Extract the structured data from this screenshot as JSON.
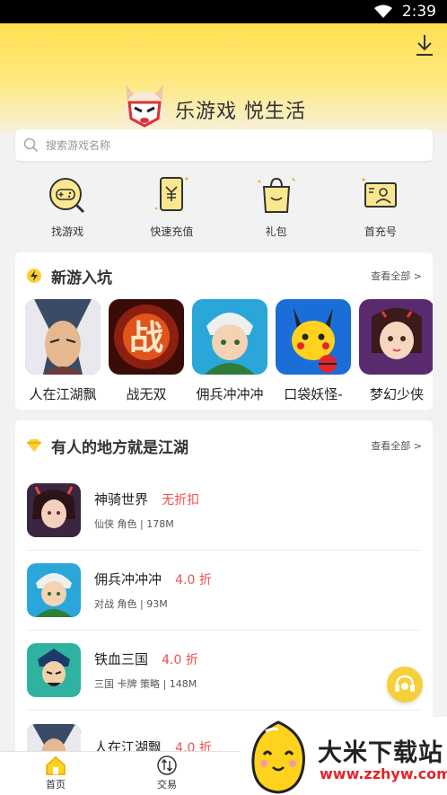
{
  "status": {
    "time": "2:39"
  },
  "header": {
    "slogan": "乐游戏 悦生活"
  },
  "search": {
    "placeholder": "搜索游戏名称"
  },
  "quick_actions": [
    {
      "label": "找游戏",
      "icon": "game-controller-icon"
    },
    {
      "label": "快速充值",
      "icon": "recharge-icon"
    },
    {
      "label": "礼包",
      "icon": "gift-bag-icon"
    },
    {
      "label": "首充号",
      "icon": "account-card-icon"
    }
  ],
  "new_games": {
    "title": "新游入坑",
    "more": "查看全部 >",
    "items": [
      {
        "name": "人在江湖飘"
      },
      {
        "name": "战无双"
      },
      {
        "name": "佣兵冲冲冲"
      },
      {
        "name": "口袋妖怪-"
      },
      {
        "name": "梦幻少侠"
      }
    ]
  },
  "jianghu": {
    "title": "有人的地方就是江湖",
    "more": "查看全部 >",
    "items": [
      {
        "name": "神骑世界",
        "discount": "无折扣",
        "meta": "仙侠 角色 | 178M"
      },
      {
        "name": "佣兵冲冲冲",
        "discount": "4.0 折",
        "meta": "对战 角色 | 93M"
      },
      {
        "name": "铁血三国",
        "discount": "4.0 折",
        "meta": "三国 卡牌 策略 | 148M"
      },
      {
        "name": "人在江湖飘",
        "discount": "4.0 折",
        "meta": ""
      }
    ]
  },
  "tabbar": [
    {
      "label": "首页"
    },
    {
      "label": "交易"
    }
  ],
  "watermark": {
    "title": "大米下载站",
    "url": "www.zzhyw.com"
  },
  "colors": {
    "brand_yellow": "#ffe04f",
    "discount_red": "#f05050",
    "watermark_red": "#e3262b"
  }
}
